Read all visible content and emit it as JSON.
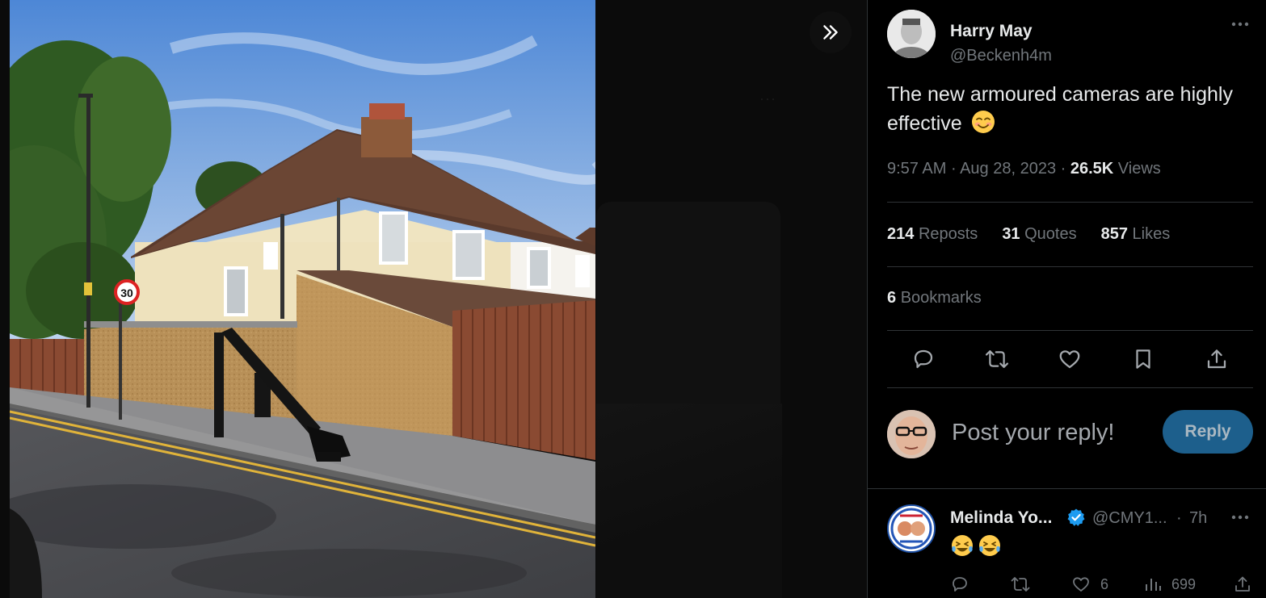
{
  "tweet": {
    "author_name": "Harry May",
    "author_handle": "@Beckenh4m",
    "text": "The new armoured cameras are highly effective",
    "text_emoji": "smiling-face-emoji",
    "time": "9:57 AM",
    "date": "Aug 28, 2023",
    "views_count": "26.5K",
    "views_label": "Views"
  },
  "stats": {
    "reposts_count": "214",
    "reposts_label": "Reposts",
    "quotes_count": "31",
    "quotes_label": "Quotes",
    "likes_count": "857",
    "likes_label": "Likes",
    "bookmarks_count": "6",
    "bookmarks_label": "Bookmarks"
  },
  "actions": [
    "reply-icon",
    "repost-icon",
    "like-icon",
    "bookmark-icon",
    "share-icon"
  ],
  "composer": {
    "placeholder": "Post your reply!",
    "button_label": "Reply"
  },
  "reply": {
    "name": "Melinda Yo...",
    "handle": "@CMY1...",
    "separator": "·",
    "time": "7h",
    "emojis": [
      "laughing-tears-emoji",
      "laughing-tears-emoji"
    ],
    "likes": "6",
    "views": "699"
  },
  "colors": {
    "background": "#000000",
    "text_primary": "#e7e9ea",
    "text_secondary": "#71767b",
    "divider": "#2f3336",
    "reply_button": "#1d5f8c",
    "verified_badge": "#1d9bf0"
  }
}
